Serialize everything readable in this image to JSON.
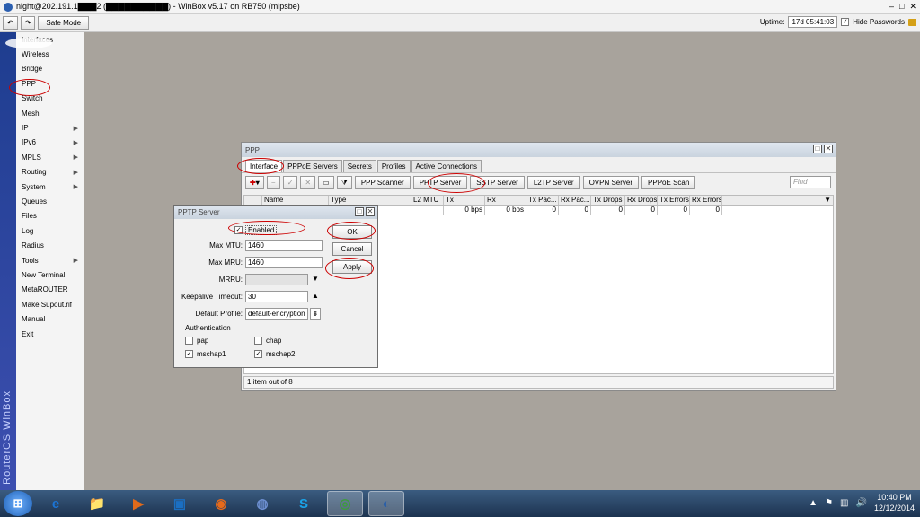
{
  "titlebar": {
    "title": "night@202.191.1▇▇▇2 (▇▇▇▇▇▇▇▇▇▇) - WinBox v5.17 on RB750 (mipsbe)",
    "min": "–",
    "max": "□",
    "close": "✕"
  },
  "toolbar": {
    "undo": "↶",
    "redo": "↷",
    "safe_mode": "Safe Mode",
    "uptime_label": "Uptime:",
    "uptime_value": "17d 05:41:03",
    "hide_passwords": "Hide Passwords",
    "check": "✓"
  },
  "brand": {
    "text": "RouterOS WinBox"
  },
  "sidebar": {
    "items": [
      {
        "label": "Interfaces",
        "arrow": ""
      },
      {
        "label": "Wireless",
        "arrow": ""
      },
      {
        "label": "Bridge",
        "arrow": ""
      },
      {
        "label": "PPP",
        "arrow": ""
      },
      {
        "label": "Switch",
        "arrow": ""
      },
      {
        "label": "Mesh",
        "arrow": ""
      },
      {
        "label": "IP",
        "arrow": "▶"
      },
      {
        "label": "IPv6",
        "arrow": "▶"
      },
      {
        "label": "MPLS",
        "arrow": "▶"
      },
      {
        "label": "Routing",
        "arrow": "▶"
      },
      {
        "label": "System",
        "arrow": "▶"
      },
      {
        "label": "Queues",
        "arrow": ""
      },
      {
        "label": "Files",
        "arrow": ""
      },
      {
        "label": "Log",
        "arrow": ""
      },
      {
        "label": "Radius",
        "arrow": ""
      },
      {
        "label": "Tools",
        "arrow": "▶"
      },
      {
        "label": "New Terminal",
        "arrow": ""
      },
      {
        "label": "MetaROUTER",
        "arrow": ""
      },
      {
        "label": "Make Supout.rif",
        "arrow": ""
      },
      {
        "label": "Manual",
        "arrow": ""
      },
      {
        "label": "Exit",
        "arrow": ""
      }
    ]
  },
  "ppp": {
    "title": "PPP",
    "tabs": [
      "Interface",
      "PPPoE Servers",
      "Secrets",
      "Profiles",
      "Active Connections"
    ],
    "icons": {
      "add": "✚",
      "remove": "−",
      "enable": "✓",
      "disable": "✕",
      "comment": "▭",
      "filter": "⧩",
      "dropdown": "▾"
    },
    "buttons": [
      "PPP Scanner",
      "PPTP Server",
      "SSTP Server",
      "L2TP Server",
      "OVPN Server",
      "PPPoE Scan"
    ],
    "find_placeholder": "Find",
    "columns": [
      "Name",
      "Type",
      "L2 MTU",
      "Tx",
      "Rx",
      "Tx Pac...",
      "Rx Pac...",
      "Tx Drops",
      "Rx Drops",
      "Tx Errors",
      "Rx Errors"
    ],
    "row": [
      "",
      "",
      "",
      "0 bps",
      "0 bps",
      "0",
      "0",
      "0",
      "0",
      "0",
      "0"
    ],
    "status": "1 item out of 8"
  },
  "pptp": {
    "title": "PPTP Server",
    "enabled": "Enabled",
    "max_mtu_label": "Max MTU:",
    "max_mtu": "1460",
    "max_mru_label": "Max MRU:",
    "max_mru": "1460",
    "mrru_label": "MRRU:",
    "mrru": "",
    "keepalive_label": "Keepalive Timeout:",
    "keepalive": "30",
    "profile_label": "Default Profile:",
    "profile": "default-encryption",
    "auth_label": "Authentication",
    "auth": [
      {
        "label": "pap",
        "checked": ""
      },
      {
        "label": "chap",
        "checked": ""
      },
      {
        "label": "mschap1",
        "checked": "✓"
      },
      {
        "label": "mschap2",
        "checked": "✓"
      }
    ],
    "ok": "OK",
    "cancel": "Cancel",
    "apply": "Apply"
  },
  "taskbar": {
    "start": "⊞",
    "apps": [
      "e",
      "📁",
      "▶",
      "▣",
      "◉",
      "◍",
      "S",
      "◎",
      "◐"
    ],
    "tray_icons": [
      "▲",
      "⚑",
      "▥",
      "🔊"
    ],
    "time": "10:40 PM",
    "date": "12/12/2014"
  },
  "colors": {
    "accent": "#1e3d8f",
    "annotation": "#cc0000"
  }
}
